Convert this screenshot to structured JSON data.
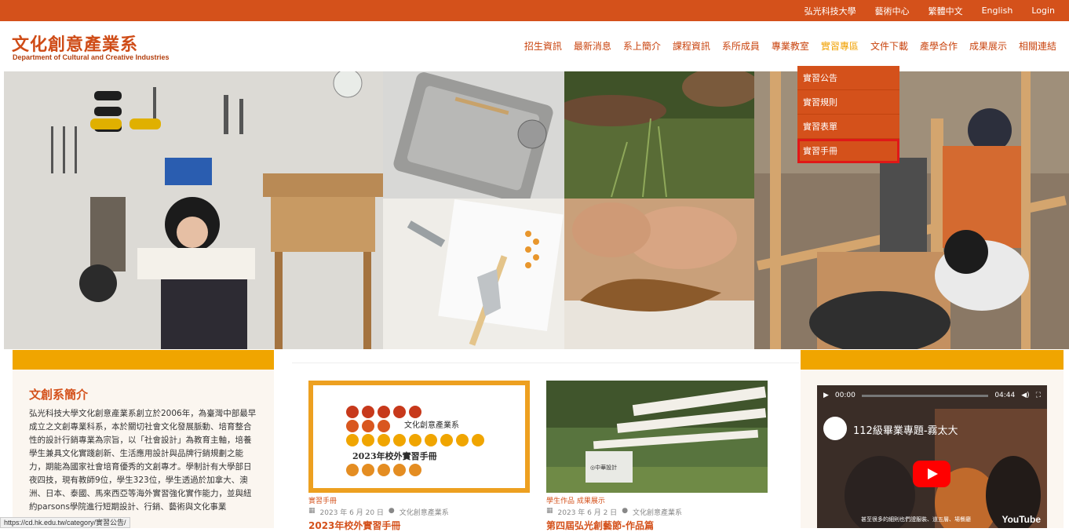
{
  "topbar": {
    "links": [
      "弘光科技大學",
      "藝術中心",
      "繁體中文",
      "English",
      "Login"
    ]
  },
  "header": {
    "title": "文化創意產業系",
    "subtitle": "Department of Cultural and Creative Industries"
  },
  "nav": {
    "items": [
      "招生資訊",
      "最新消息",
      "系上簡介",
      "課程資訊",
      "系所成員",
      "專業教室",
      "實習專區",
      "文件下載",
      "產學合作",
      "成果展示",
      "相關連結"
    ],
    "active_index": 6
  },
  "dropdown": {
    "items": [
      "實習公告",
      "實習規則",
      "實習表單",
      "實習手冊"
    ],
    "highlighted_index": 3
  },
  "intro": {
    "heading": "文創系簡介",
    "text": "弘光科技大學文化創意產業系創立於2006年，為臺灣中部最早成立之文創專業科系，本於關切社會文化發展脈動、培育整合性的設計行銷專業為宗旨，以「社會設計」為教育主軸，培養學生兼具文化實踐創新、生活應用設計與品牌行銷規劃之能力，期能為國家社會培育優秀的文創專才。學制計有大學部日夜四技，現有教師9位，學生323位，學生透過於加拿大、澳洲、日本、泰國、馬來西亞等海外實習強化實作能力，並與紐約parsons學院進行短期設計、行銷、藝術與文化事業"
  },
  "posts": [
    {
      "thumb_title": "2023年校外實習手冊",
      "thumb_brand": "文化創意產業系",
      "category": "實習手冊",
      "date": "2023 年 6 月 20 日",
      "author": "文化創意產業系",
      "title": "2023年校外實習手冊"
    },
    {
      "thumb_sign": "◎中華設計",
      "category": "學生作品 成果展示",
      "date": "2023 年 6 月 2 日",
      "author": "文化創意產業系",
      "title": "第四屆弘光創藝節-作品篇"
    }
  ],
  "video": {
    "time_current": "00:00",
    "time_total": "04:44",
    "title": "112級畢業專題-霧太大",
    "caption": "甚至很多的細則也們證服裝、道五層、場餐廳",
    "platform": "YouTube"
  },
  "status_url": "https://cd.hk.edu.tw/category/實習公告/",
  "colors": {
    "brand_orange": "#d4511b",
    "accent_yellow": "#f0a500",
    "highlight_red": "#e01818"
  }
}
